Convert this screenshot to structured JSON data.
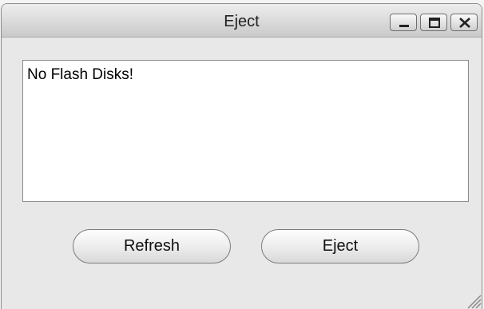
{
  "window": {
    "title": "Eject",
    "controls": {
      "minimize": "minimize-icon",
      "maximize": "maximize-icon",
      "close": "close-icon"
    }
  },
  "disk_list": {
    "items": [
      "No Flash Disks!"
    ]
  },
  "buttons": {
    "refresh_label": "Refresh",
    "eject_label": "Eject"
  },
  "colors": {
    "title_bar_top": "#ededed",
    "title_bar_bottom": "#c9c9c9",
    "panel_background": "#e8e8e8",
    "list_background": "#ffffff"
  }
}
